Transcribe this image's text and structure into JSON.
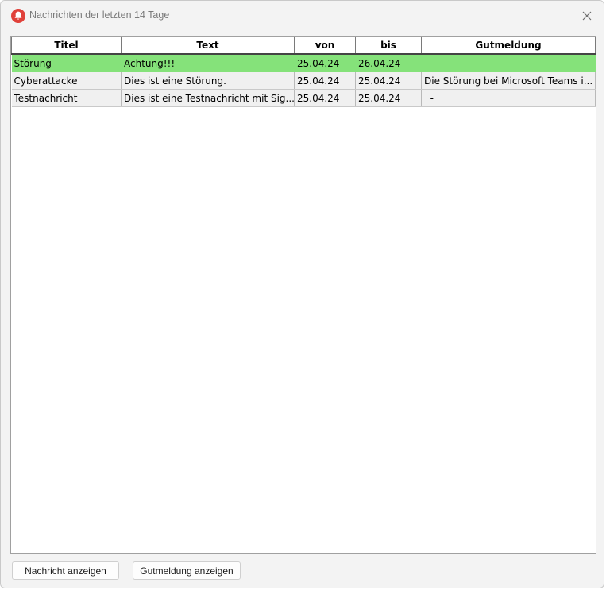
{
  "window": {
    "title": "Nachrichten der letzten 14 Tage",
    "accent_color": "#e0413a"
  },
  "table": {
    "columns": [
      "Titel",
      "Text",
      "von",
      "bis",
      "Gutmeldung"
    ],
    "rows": [
      {
        "titel": "Störung",
        "text": "Achtung!!!",
        "von": "25.04.24",
        "bis": "26.04.24",
        "gutmeldung": "",
        "selected": true
      },
      {
        "titel": "Cyberattacke",
        "text": "Dies ist eine Störung.",
        "von": "25.04.24",
        "bis": "25.04.24",
        "gutmeldung": "Die Störung bei Microsoft Teams i...",
        "selected": false
      },
      {
        "titel": "Testnachricht",
        "text": "Dies ist eine Testnachricht mit Sig...",
        "von": "25.04.24",
        "bis": "25.04.24",
        "gutmeldung": "  -",
        "selected": false
      }
    ],
    "selected_row_color": "#85e27a"
  },
  "buttons": {
    "show_message": "Nachricht anzeigen",
    "show_gutmeldung": "Gutmeldung anzeigen"
  }
}
